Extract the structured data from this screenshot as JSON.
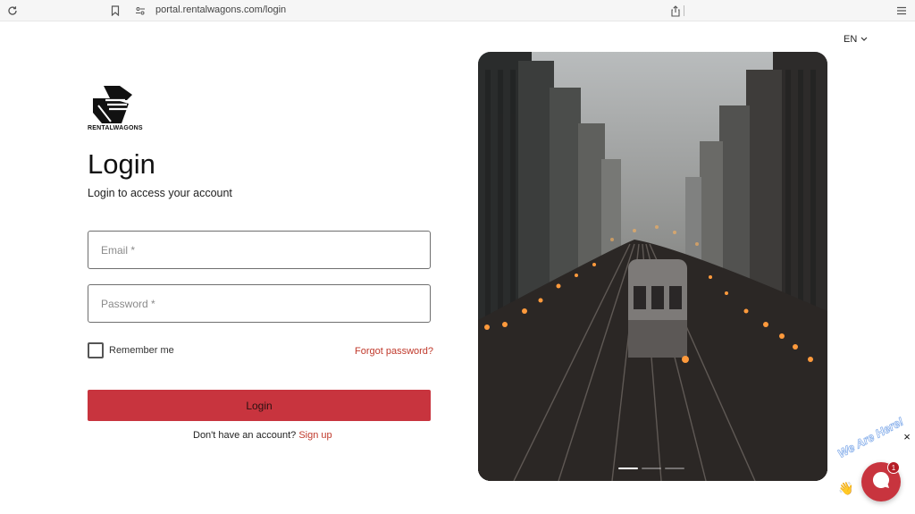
{
  "browser": {
    "url": "portal.rentalwagons.com/login"
  },
  "language": {
    "current": "EN"
  },
  "brand": {
    "name": "RENTALWAGONS"
  },
  "login": {
    "title": "Login",
    "subtitle": "Login to access your account",
    "email_placeholder": "Email *",
    "password_placeholder": "Password *",
    "remember_label": "Remember me",
    "forgot_label": "Forgot password?",
    "button_label": "Login",
    "signup_prompt": "Don't have an account?",
    "signup_link": "Sign up"
  },
  "carousel": {
    "slide_count": 3,
    "active_index": 0
  },
  "chat": {
    "greeting": "We Are Here!",
    "badge_count": "1",
    "close_symbol": "×"
  },
  "colors": {
    "accent": "#c8343e",
    "link": "#c0392b"
  }
}
